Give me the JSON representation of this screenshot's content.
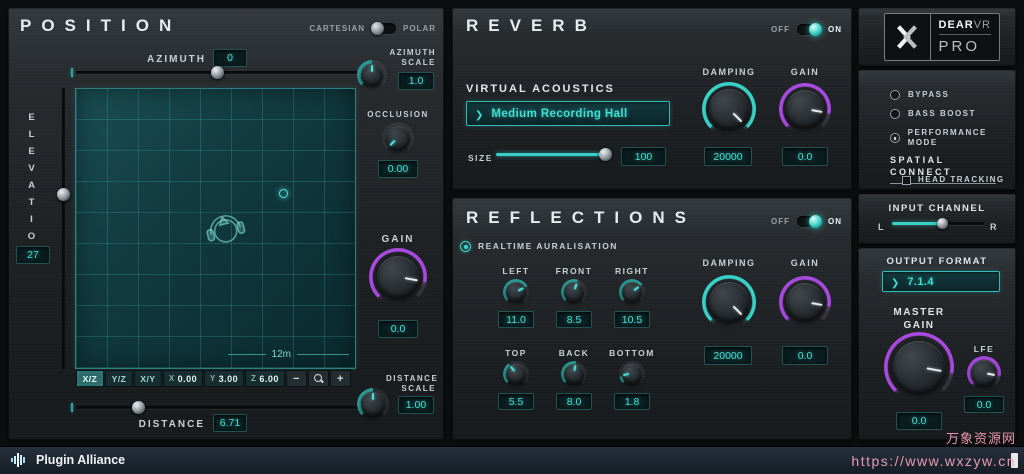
{
  "position": {
    "title": "POSITION",
    "mode": {
      "cartesian": "CARTESIAN",
      "polar": "POLAR"
    },
    "azimuth": {
      "label": "AZIMUTH",
      "value": "0"
    },
    "azimuth_scale": {
      "label": "AZIMUTH SCALE",
      "value": "1.0"
    },
    "occlusion": {
      "label": "OCCLUSION",
      "value": "0.00"
    },
    "elevation": {
      "label": "ELEVATION",
      "value": "27"
    },
    "gain": {
      "label": "GAIN",
      "value": "0.0"
    },
    "distance": {
      "label": "DISTANCE",
      "value": "6.71"
    },
    "distance_scale": {
      "label": "DISTANCE SCALE",
      "value": "1.00"
    },
    "pad": {
      "scale_label": "12m"
    },
    "planes": {
      "xz": "X/Z",
      "yz": "Y/Z",
      "xy": "X/Y"
    },
    "coords": {
      "x": {
        "axis": "X",
        "value": "0.00"
      },
      "y": {
        "axis": "Y",
        "value": "3.00"
      },
      "z": {
        "axis": "Z",
        "value": "6.00"
      }
    },
    "zoom": {
      "out": "−",
      "in": "+"
    }
  },
  "reverb": {
    "title": "REVERB",
    "toggle": {
      "off": "OFF",
      "on": "ON"
    },
    "virtual_acoustics": {
      "label": "VIRTUAL ACOUSTICS",
      "selected": "Medium Recording Hall"
    },
    "size": {
      "label": "SIZE",
      "value": "100"
    },
    "damping": {
      "label": "DAMPING",
      "value": "20000"
    },
    "gain": {
      "label": "GAIN",
      "value": "0.0"
    }
  },
  "reflections": {
    "title": "REFLECTIONS",
    "toggle": {
      "off": "OFF",
      "on": "ON"
    },
    "realtime": "REALTIME AURALISATION",
    "left": {
      "label": "LEFT",
      "value": "11.0"
    },
    "front": {
      "label": "FRONT",
      "value": "8.5"
    },
    "right": {
      "label": "RIGHT",
      "value": "10.5"
    },
    "top": {
      "label": "TOP",
      "value": "5.5"
    },
    "back": {
      "label": "BACK",
      "value": "8.0"
    },
    "bottom": {
      "label": "BOTTOM",
      "value": "1.8"
    },
    "damping": {
      "label": "DAMPING",
      "value": "20000"
    },
    "gain": {
      "label": "GAIN",
      "value": "0.0"
    }
  },
  "master": {
    "logo": {
      "dear": "DEAR",
      "vr": "VR",
      "pro": "PRO"
    },
    "modes": {
      "bypass": "BYPASS",
      "bass_boost": "BASS BOOST",
      "performance": "PERFORMANCE MODE"
    },
    "spatial_connect": {
      "label": "SPATIAL CONNECT",
      "head_tracking": "HEAD TRACKING"
    },
    "input_channel": {
      "label": "INPUT CHANNEL",
      "l": "L",
      "r": "R"
    },
    "output_format": {
      "label": "OUTPUT FORMAT",
      "selected": "7.1.4"
    },
    "master_gain": {
      "label": "MASTER GAIN",
      "value": "0.0"
    },
    "lfe": {
      "label": "LFE",
      "value": "0.0"
    }
  },
  "footer": {
    "brand": "Plugin Alliance"
  },
  "watermark": {
    "line1": "万象资源网",
    "line2": "https://www.wxzyw.cn"
  },
  "colors": {
    "accent_teal": "#38d1c8",
    "accent_purple": "#a84ae0"
  }
}
